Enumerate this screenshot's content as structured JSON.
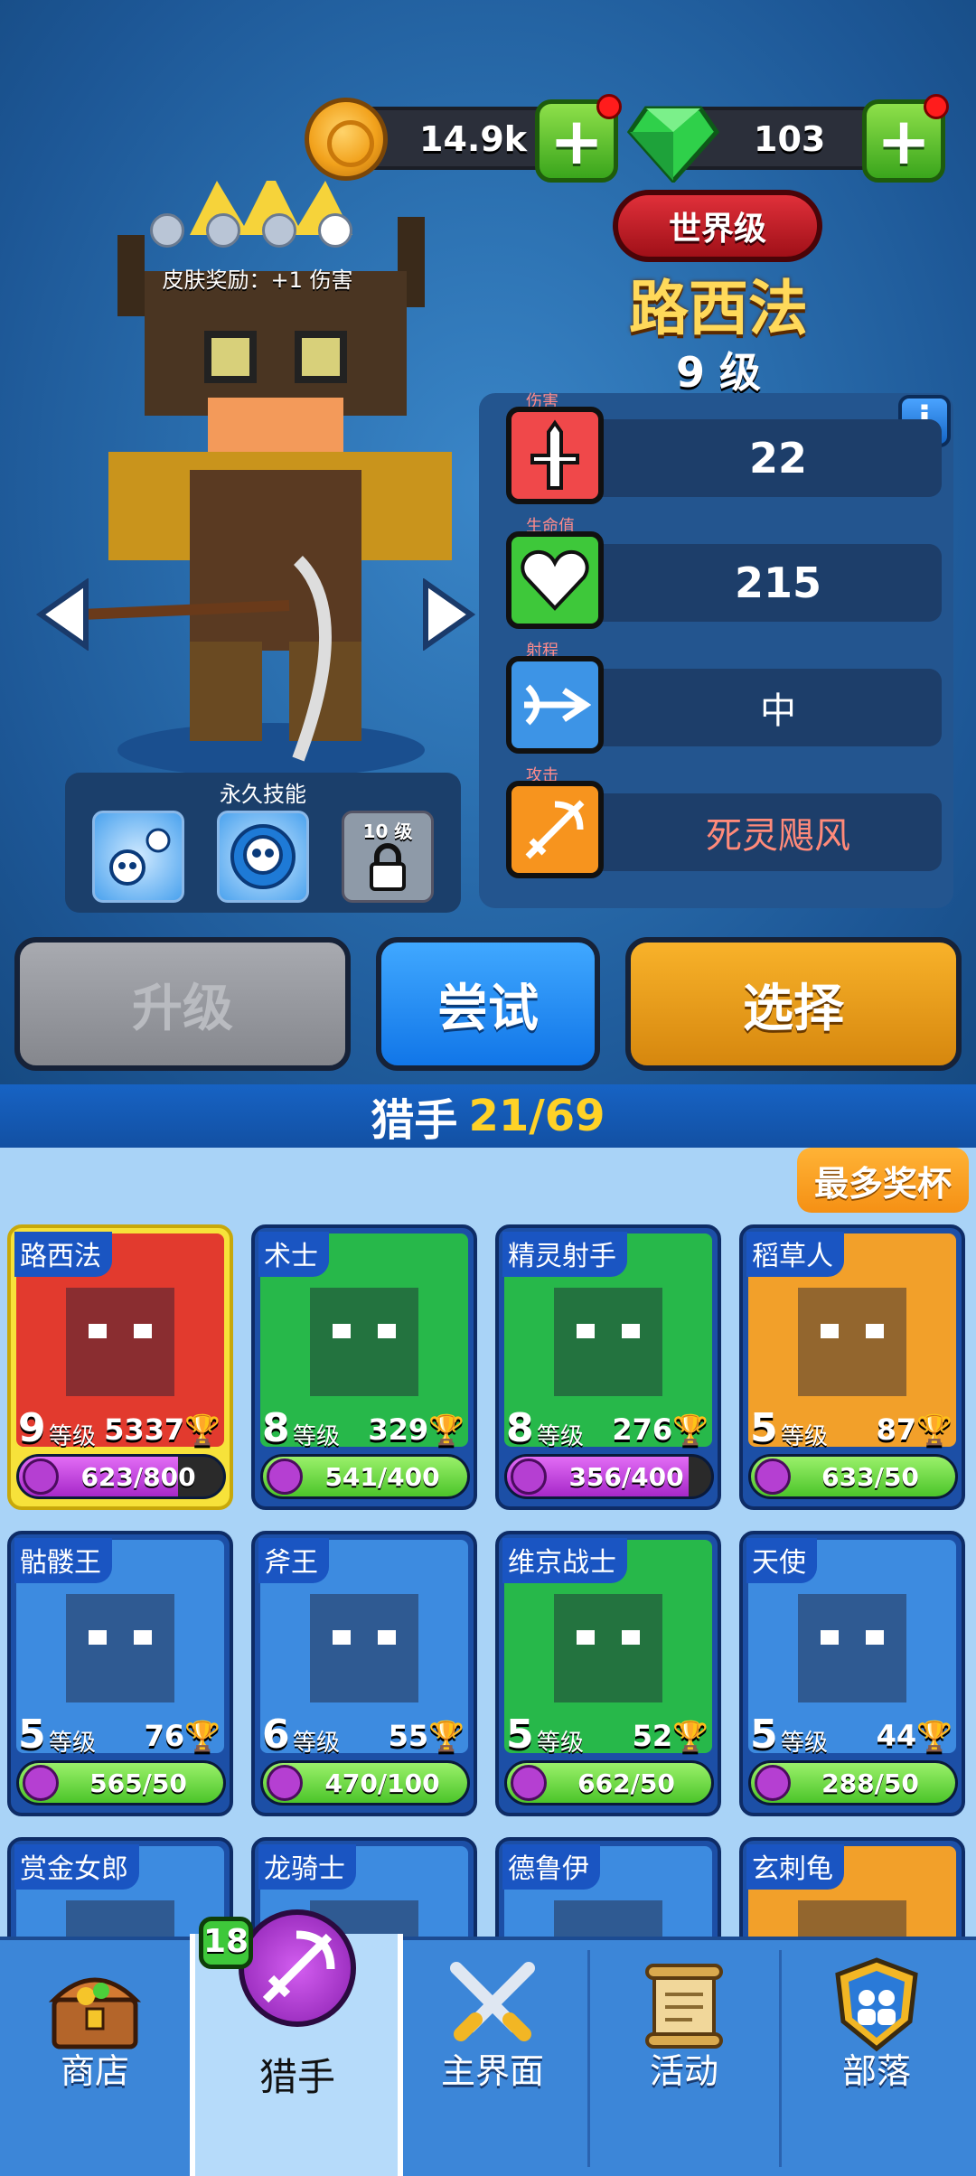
{
  "currency": {
    "coins": "14.9k",
    "gems": "103"
  },
  "hero": {
    "rarity_badge": "世界级",
    "name": "路西法",
    "level": "9 级",
    "skin_bonus": "皮肤奖励：+1 伤害",
    "stats": [
      {
        "caption": "伤害",
        "value": "22",
        "icon": "dagger-icon",
        "color": "#f0484a"
      },
      {
        "caption": "生命值",
        "value": "215",
        "icon": "heart-icon",
        "color": "#3ec83a"
      },
      {
        "caption": "射程",
        "value": "中",
        "icon": "bow-range-icon",
        "color": "#3d94e6"
      },
      {
        "caption": "攻击",
        "value": "死灵飓风",
        "icon": "crossbow-icon",
        "color": "#f7941e"
      }
    ],
    "permanent_skills_title": "永久技能",
    "locked_skill_level": "10 级"
  },
  "actions": {
    "upgrade": "升级",
    "try": "尝试",
    "select": "选择"
  },
  "section": {
    "title": "猎手",
    "count": "21/69",
    "sort_button": "最多奖杯"
  },
  "level_suffix": "等级",
  "heroes": [
    {
      "name": "路西法",
      "level": "9",
      "trophies": "5337",
      "progress": "623/800",
      "fill": 0.78,
      "bg": "#e23a2e",
      "selected": true
    },
    {
      "name": "术士",
      "level": "8",
      "trophies": "329",
      "progress": "541/400",
      "fill": 1.0,
      "bg": "#27b84a"
    },
    {
      "name": "精灵射手",
      "level": "8",
      "trophies": "276",
      "progress": "356/400",
      "fill": 0.89,
      "bg": "#27b84a"
    },
    {
      "name": "稻草人",
      "level": "5",
      "trophies": "87",
      "progress": "633/50",
      "fill": 1.0,
      "bg": "#f2a02a"
    },
    {
      "name": "骷髅王",
      "level": "5",
      "trophies": "76",
      "progress": "565/50",
      "fill": 1.0,
      "bg": "#3d8be0"
    },
    {
      "name": "斧王",
      "level": "6",
      "trophies": "55",
      "progress": "470/100",
      "fill": 1.0,
      "bg": "#3d8be0"
    },
    {
      "name": "维京战士",
      "level": "5",
      "trophies": "52",
      "progress": "662/50",
      "fill": 1.0,
      "bg": "#27b84a"
    },
    {
      "name": "天使",
      "level": "5",
      "trophies": "44",
      "progress": "288/50",
      "fill": 1.0,
      "bg": "#3d8be0"
    },
    {
      "name": "赏金女郎",
      "bg": "#3d8be0"
    },
    {
      "name": "龙骑士",
      "bg": "#3d8be0"
    },
    {
      "name": "德鲁伊",
      "bg": "#3d8be0"
    },
    {
      "name": "玄刺龟",
      "bg": "#f2a02a"
    }
  ],
  "nav": {
    "items": [
      {
        "label": "商店",
        "icon": "treasure-chest-icon"
      },
      {
        "label": "猎手",
        "icon": "crossbow-badge-icon",
        "badge": "18",
        "active": true
      },
      {
        "label": "主界面",
        "icon": "crossed-swords-icon"
      },
      {
        "label": "活动",
        "icon": "scroll-icon"
      },
      {
        "label": "部落",
        "icon": "clan-shield-icon"
      }
    ]
  }
}
